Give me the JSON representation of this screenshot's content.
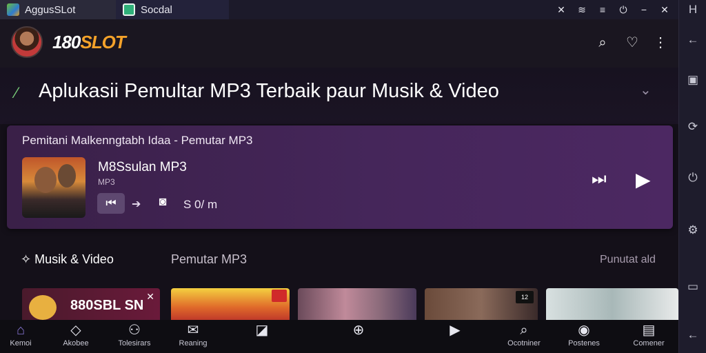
{
  "tabs": [
    {
      "label": "AggusSLot",
      "icon": "app-icon"
    },
    {
      "label": "Socdal",
      "icon": "app-icon"
    }
  ],
  "window_controls": [
    "✕",
    "wifi-icon",
    "≡",
    "⏻",
    "−",
    "✕"
  ],
  "header": {
    "brand_num": "180",
    "brand_text": "SLOT",
    "icons": [
      "search-icon",
      "heart-icon",
      "more-icon"
    ]
  },
  "page_title": "Aplukasii Pemultar MP3 Terbaik paur Musik & Video",
  "player": {
    "heading": "Pemitani Malkenngtabh Idaa - Pemutar MP3",
    "track_title": "M8Ssulan MP3",
    "track_sub": "MP3",
    "time": "S 0/ m"
  },
  "section": {
    "left": "Musik & Video",
    "mid": "Pemutar MP3",
    "right": "Punutat ald"
  },
  "thumbnails": [
    {
      "text": "880SBL SN"
    },
    {
      "text": ""
    },
    {
      "text": ""
    },
    {
      "text": "12"
    },
    {
      "text": ""
    }
  ],
  "bottom_nav": [
    {
      "label": "Kemoi",
      "icon": "home-icon"
    },
    {
      "label": "Akobee",
      "icon": "diamond-icon"
    },
    {
      "label": "Tolesirars",
      "icon": "people-icon"
    },
    {
      "label": "Reaning",
      "icon": "mail-icon"
    },
    {
      "label": "",
      "icon": "tag-icon"
    },
    {
      "label": "",
      "icon": "add-circle-icon"
    },
    {
      "label": "",
      "icon": "play-icon"
    },
    {
      "label": "Ocotniner",
      "icon": "search-icon"
    },
    {
      "label": "Postenes",
      "icon": "profile-icon"
    },
    {
      "label": "Comener",
      "icon": "wallet-icon"
    }
  ],
  "colors": {
    "brand_accent": "#f4a22a",
    "player_bg": "#45265a",
    "nav_active": "#8a78d8"
  }
}
